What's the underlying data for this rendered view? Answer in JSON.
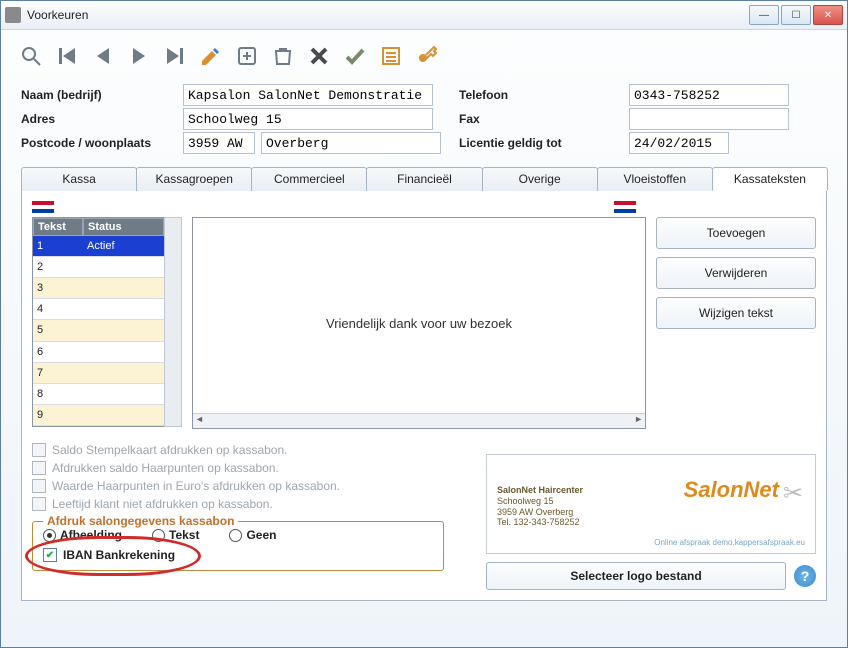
{
  "window": {
    "title": "Voorkeuren"
  },
  "toolbar_icons": [
    "search",
    "first",
    "prev",
    "next",
    "last",
    "edit",
    "new",
    "delete",
    "cancel",
    "ok",
    "list",
    "key"
  ],
  "form": {
    "left": {
      "naam_label": "Naam (bedrijf)",
      "naam_value": "Kapsalon SalonNet Demonstratie",
      "adres_label": "Adres",
      "adres_value": "Schoolweg 15",
      "postcode_label": "Postcode / woonplaats",
      "postcode_value": "3959 AW",
      "plaats_value": "Overberg"
    },
    "right": {
      "telefoon_label": "Telefoon",
      "telefoon_value": "0343-758252",
      "fax_label": "Fax",
      "fax_value": "",
      "licentie_label": "Licentie geldig tot",
      "licentie_value": "24/02/2015"
    }
  },
  "tabs": [
    "Kassa",
    "Kassagroepen",
    "Commercieel",
    "Financieël",
    "Overige",
    "Vloeistoffen",
    "Kassateksten"
  ],
  "active_tab": "Kassateksten",
  "grid": {
    "headers": {
      "tekst": "Tekst",
      "status": "Status"
    },
    "rows": [
      {
        "n": "1",
        "status": "Actief",
        "selected": true
      },
      {
        "n": "2",
        "status": ""
      },
      {
        "n": "3",
        "status": ""
      },
      {
        "n": "4",
        "status": ""
      },
      {
        "n": "5",
        "status": ""
      },
      {
        "n": "6",
        "status": ""
      },
      {
        "n": "7",
        "status": ""
      },
      {
        "n": "8",
        "status": ""
      },
      {
        "n": "9",
        "status": ""
      }
    ]
  },
  "preview_text": "Vriendelijk dank voor uw bezoek",
  "side_buttons": {
    "add": "Toevoegen",
    "del": "Verwijderen",
    "edit": "Wijzigen tekst"
  },
  "checks": {
    "c1": "Saldo Stempelkaart afdrukken op kassabon.",
    "c2": "Afdrukken saldo Haarpunten op kassabon.",
    "c3": "Waarde Haarpunten in Euro's afdrukken op kassabon.",
    "c4": "Leeftijd klant niet afdrukken op kassabon."
  },
  "groupbox": {
    "legend": "Afdruk salongegevens kassabon",
    "radios": {
      "afbeelding": "Afbeelding",
      "tekst": "Tekst",
      "geen": "Geen"
    },
    "iban_label": "IBAN Bankrekening"
  },
  "logo_card": {
    "line1": "SalonNet Haircenter",
    "line2": "Schoolweg 15",
    "line3": "3959 AW  Overberg",
    "line4": "Tel. 132-343-758252",
    "brand": "SalonNet",
    "sub": "Online afspraak demo.kappersafspraak.eu"
  },
  "select_logo_btn": "Selecteer logo bestand"
}
